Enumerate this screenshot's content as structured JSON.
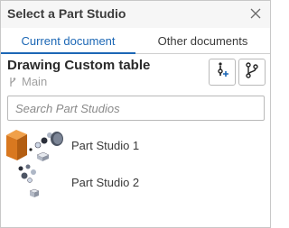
{
  "dialog": {
    "title": "Select a Part Studio",
    "close_icon": "close-icon"
  },
  "tabs": [
    {
      "label": "Current document",
      "active": true
    },
    {
      "label": "Other documents",
      "active": false
    }
  ],
  "document": {
    "name": "Drawing Custom table",
    "branch_icon": "branch-icon",
    "branch": "Main"
  },
  "actions": {
    "version_icon": "add-version-icon",
    "branch_icon": "branch-graph-icon"
  },
  "search": {
    "placeholder": "Search Part Studios",
    "value": ""
  },
  "part_studios": [
    {
      "name": "Part Studio 1",
      "thumbnail_icon": "part-studio-thumbnail"
    },
    {
      "name": "Part Studio 2",
      "thumbnail_icon": "part-studio-thumbnail"
    }
  ],
  "colors": {
    "accent": "#1c67b5",
    "header_bg": "#f6f6f6",
    "box_orange": "#d9781f"
  }
}
